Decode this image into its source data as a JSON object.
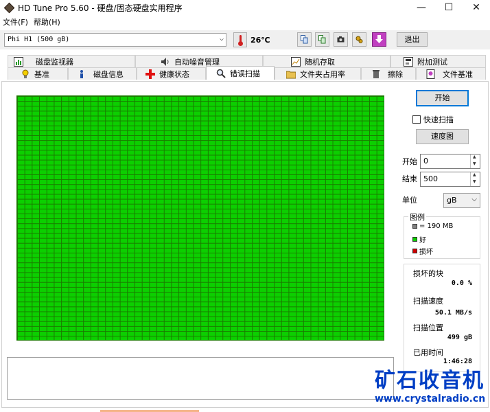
{
  "window": {
    "title": "HD Tune Pro 5.60 - 硬盘/固态硬盘实用程序",
    "minimize": "—",
    "maximize": "☐",
    "close": "✕"
  },
  "menu": [
    "文件(F)",
    "帮助(H)"
  ],
  "toolbar": {
    "drive": "Phi     H1 (500 gB)",
    "temperature": "26℃",
    "exit_label": "退出"
  },
  "tabs_row1": [
    "磁盘监视器",
    "自动噪音管理",
    "随机存取",
    "附加测试"
  ],
  "tabs_row2": [
    "基准",
    "磁盘信息",
    "健康状态",
    "错误扫描",
    "文件夹占用率",
    "擦除",
    "文件基准"
  ],
  "active_tab": "错误扫描",
  "panel": {
    "start_button": "开始",
    "quick_scan": "快速扫描",
    "speed_map_button": "速度图",
    "start_label": "开始",
    "start_value": "0",
    "end_label": "结束",
    "end_value": "500",
    "unit_label": "单位",
    "unit_value": "gB",
    "legend_title": "图例",
    "legend_block": "= 190 MB",
    "legend_good": "好",
    "legend_bad": "损坏"
  },
  "stats": {
    "damaged_label": "损坏的块",
    "damaged_value": "0.0 %",
    "speed_label": "扫描速度",
    "speed_value": "50.1 MB/s",
    "position_label": "扫描位置",
    "position_value": "499 gB",
    "elapsed_label": "已用时间",
    "elapsed_value": "1:46:28"
  },
  "colors": {
    "good": "#0ccf00",
    "bad": "#d00000",
    "block": "#808080"
  },
  "watermark": {
    "name": "矿石收音机",
    "url": "www.crystalradio.cn"
  }
}
